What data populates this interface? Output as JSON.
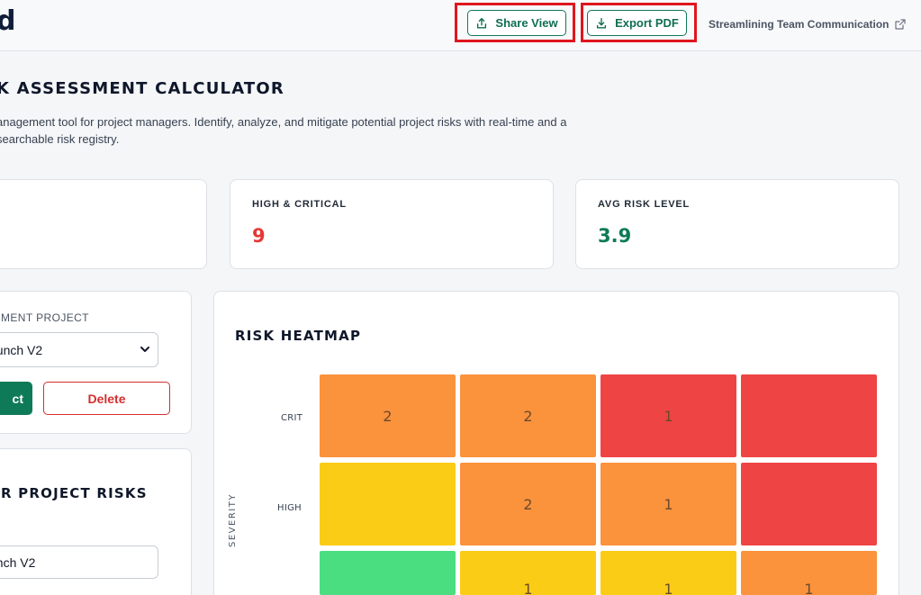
{
  "header": {
    "logo_text": "d",
    "share_label": "Share View",
    "export_label": "Export PDF",
    "external_link_label": "Streamlining Team Communication"
  },
  "page": {
    "title": "K ASSESSMENT CALCULATOR",
    "description": "anagement tool for project managers. Identify, analyze, and mitigate potential project risks with real-time and a searchable risk registry."
  },
  "stats": [
    {
      "label": "",
      "value": ""
    },
    {
      "label": "HIGH & CRITICAL",
      "value": "9",
      "color": "#e53935"
    },
    {
      "label": "AVG RISK LEVEL",
      "value": "3.9",
      "color": "#0f7a57"
    }
  ],
  "project_panel": {
    "field_label": "MENT PROJECT",
    "selected_project": "aunch V2",
    "select_button_label": "ct",
    "delete_button_label": "Delete"
  },
  "risks_panel": {
    "title": "R PROJECT RISKS",
    "project_input_value": "unch V2"
  },
  "heatmap": {
    "title": "RISK HEATMAP",
    "axis_label": "SEVERITY",
    "rows": [
      {
        "label": "CRIT",
        "cells": [
          {
            "value": "2",
            "color": "#fb923c"
          },
          {
            "value": "2",
            "color": "#fb923c"
          },
          {
            "value": "1",
            "color": "#ef4444"
          },
          {
            "value": "",
            "color": "#ef4444"
          }
        ]
      },
      {
        "label": "HIGH",
        "cells": [
          {
            "value": "",
            "color": "#facc15"
          },
          {
            "value": "2",
            "color": "#fb923c"
          },
          {
            "value": "1",
            "color": "#fb923c"
          },
          {
            "value": "",
            "color": "#ef4444"
          }
        ]
      },
      {
        "label": "",
        "cells": [
          {
            "value": "",
            "color": "#4ade80"
          },
          {
            "value": "1",
            "color": "#facc15"
          },
          {
            "value": "1",
            "color": "#facc15"
          },
          {
            "value": "1",
            "color": "#fb923c"
          }
        ]
      }
    ]
  }
}
